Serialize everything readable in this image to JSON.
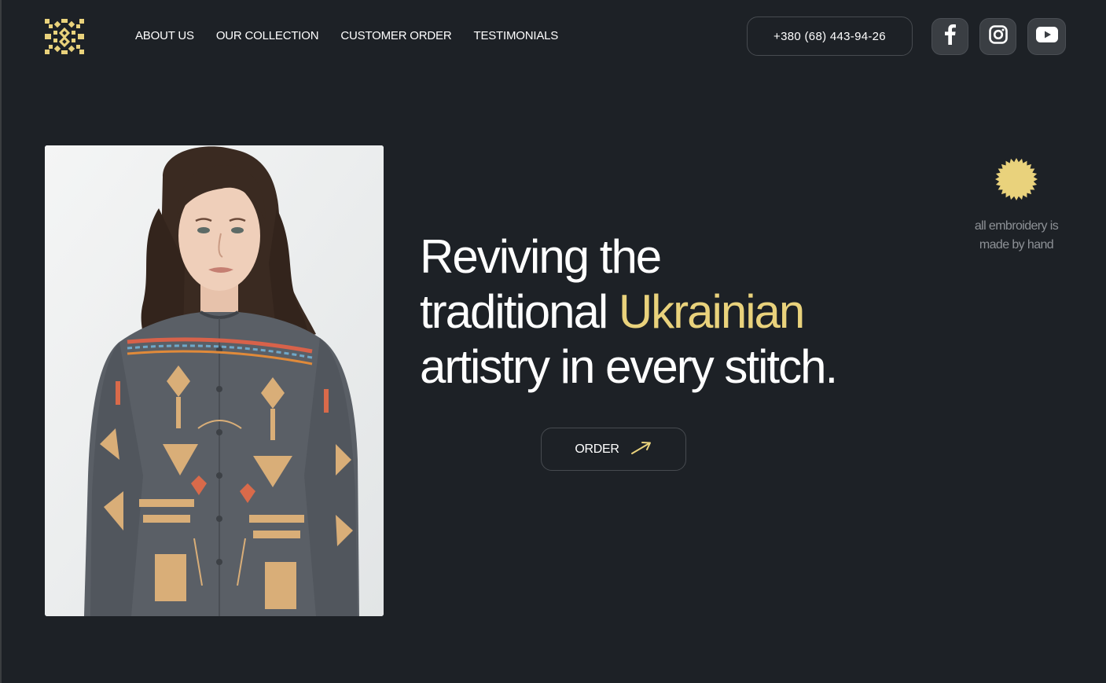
{
  "brand": {
    "logo_icon": "embroidery-ornament-icon",
    "logo_color": "#e9d27c"
  },
  "nav": {
    "items": [
      {
        "label": "ABOUT US"
      },
      {
        "label": "OUR COLLECTION"
      },
      {
        "label": "CUSTOMER ORDER"
      },
      {
        "label": "TESTIMONIALS"
      }
    ]
  },
  "contact": {
    "phone": "+380 (68) 443-94-26"
  },
  "socials": [
    {
      "icon": "facebook-icon"
    },
    {
      "icon": "instagram-icon"
    },
    {
      "icon": "youtube-icon"
    }
  ],
  "hero": {
    "title_line1": "Reviving the",
    "title_line2_pre": "traditional ",
    "title_line2_accent": "Ukrainian",
    "title_line3": "artistry in every stitch.",
    "order_label": "ORDER",
    "order_icon": "arrow-up-right-icon",
    "image_icon": "model-in-embroidered-shirt-photo"
  },
  "badge": {
    "icon": "sunburst-badge-icon",
    "text_line1": "all embroidery is",
    "text_line2": "made by hand"
  },
  "colors": {
    "background": "#1d2126",
    "accent": "#e9d27c",
    "muted_text": "#8d9196",
    "button_border": "#474b50",
    "social_bg": "#3a3e43"
  }
}
